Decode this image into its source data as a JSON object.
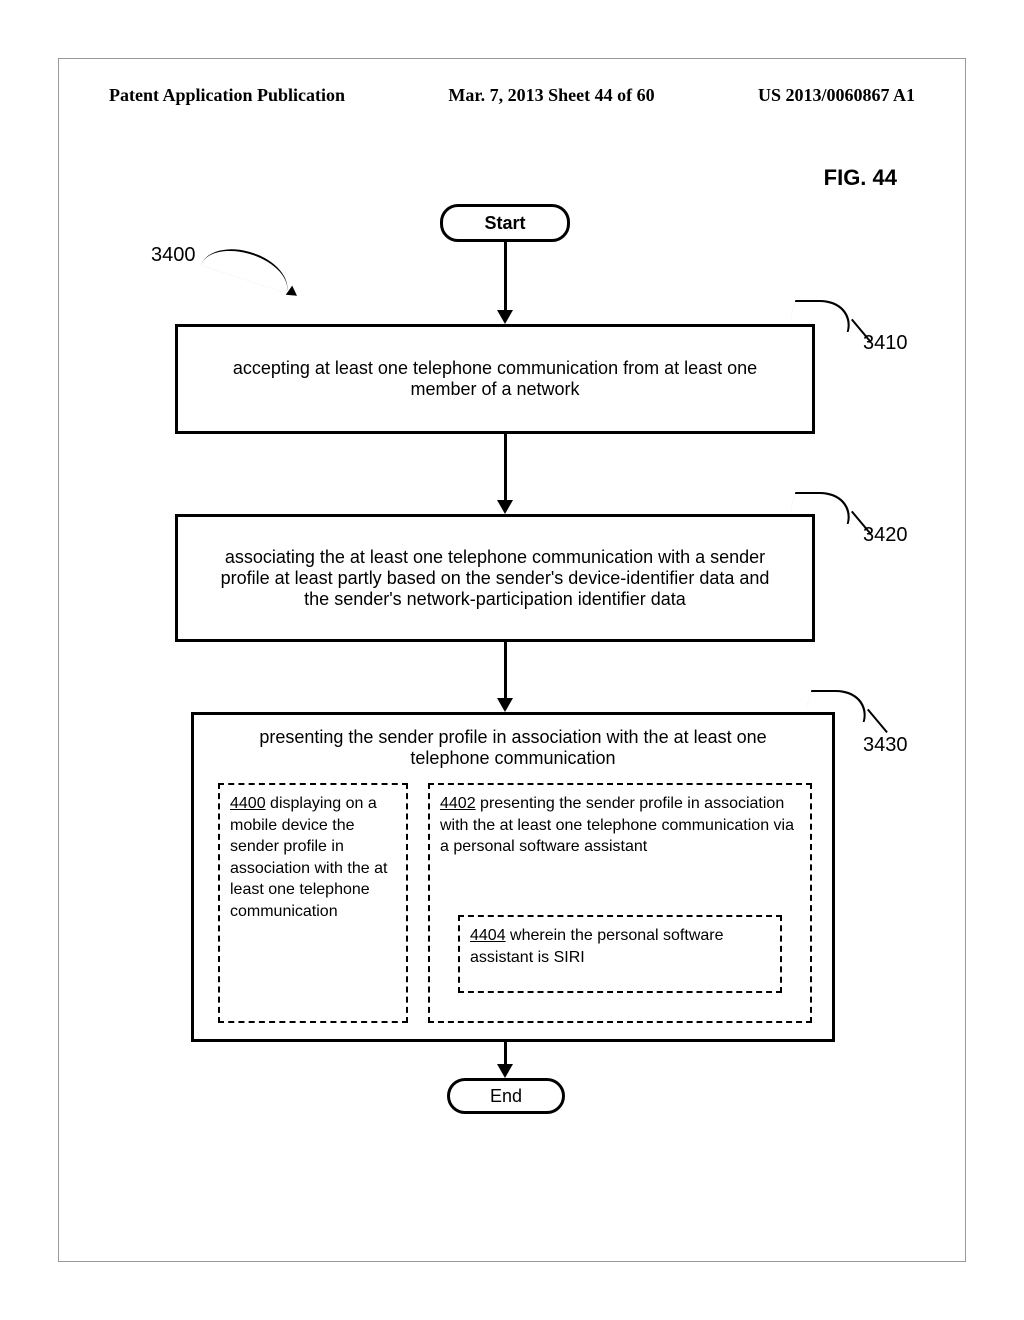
{
  "header": {
    "left": "Patent Application Publication",
    "mid": "Mar. 7, 2013  Sheet 44 of 60",
    "right": "US 2013/0060867 A1"
  },
  "figure_label": "FIG. 44",
  "refs": {
    "r3400": "3400",
    "r3410": "3410",
    "r3420": "3420",
    "r3430": "3430"
  },
  "nodes": {
    "start": "Start",
    "end": "End",
    "b3410": "accepting at least one telephone communication from at least one member of a network",
    "b3420": "associating the at least one telephone communication with a sender profile at least partly based on the sender's device-identifier data and the sender's network-participation identifier data",
    "b3430_title": "presenting the sender profile in association with the at least one telephone communication",
    "d4400_idx": "4400",
    "d4400": " displaying on a mobile device the sender profile in association with the at least one telephone communication",
    "d4402_idx": "4402",
    "d4402": " presenting the sender profile in association with the at least one telephone communication via a personal software assistant",
    "d4404_idx": "4404",
    "d4404": " wherein the personal software assistant is SIRI"
  }
}
